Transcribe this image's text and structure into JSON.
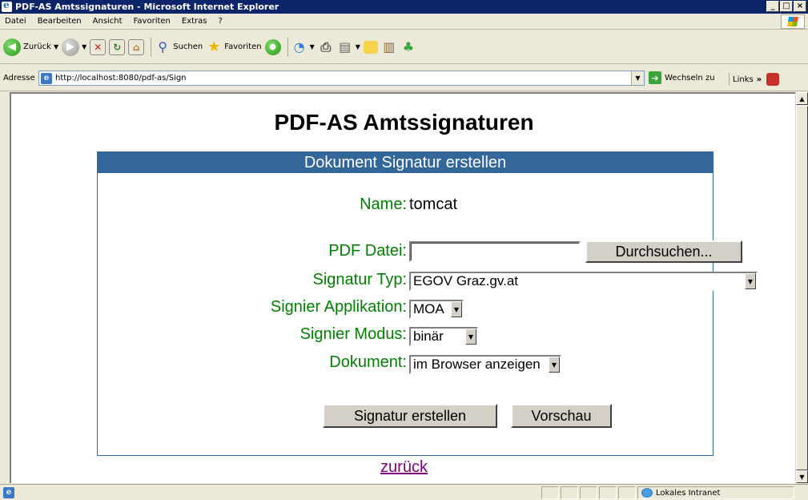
{
  "window": {
    "title": "PDF-AS Amtssignaturen - Microsoft Internet Explorer",
    "controls": [
      "_",
      "□",
      "×"
    ]
  },
  "menu": [
    "Datei",
    "Bearbeiten",
    "Ansicht",
    "Favoriten",
    "Extras",
    "?"
  ],
  "toolbar": {
    "back_label": "Zurück",
    "search_label": "Suchen",
    "favorites_label": "Favoriten"
  },
  "address": {
    "label": "Adresse",
    "url": "http://localhost:8080/pdf-as/Sign",
    "go_label": "Wechseln zu",
    "links_label": "Links"
  },
  "page": {
    "title": "PDF-AS Amtssignaturen",
    "panel_title": "Dokument Signatur erstellen",
    "name_label": "Name:",
    "name_value": "tomcat",
    "pdf_label": "PDF Datei:",
    "browse_button": "Durchsuchen...",
    "sigtype_label": "Signatur Typ:",
    "sigtype_value": "EGOV Graz.gv.at",
    "app_label": "Signier Applikation:",
    "app_value": "MOA",
    "mode_label": "Signier Modus:",
    "mode_value": "binär",
    "doc_label": "Dokument:",
    "doc_value": "im Browser anzeigen",
    "submit_button": "Signatur erstellen",
    "preview_button": "Vorschau",
    "back_link": "zurück"
  },
  "status": {
    "zone": "Lokales Intranet"
  }
}
